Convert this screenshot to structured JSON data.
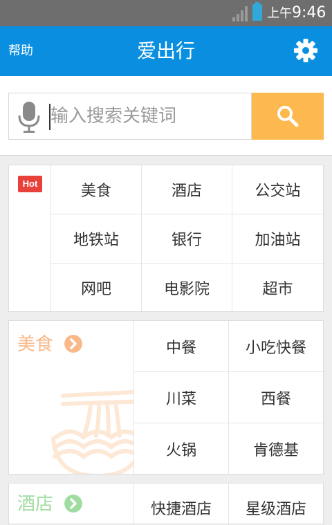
{
  "status_bar": {
    "am_pm": "上午",
    "time": "9:46"
  },
  "header": {
    "help_label": "帮助",
    "title": "爱出行"
  },
  "search": {
    "placeholder": "输入搜索关键词",
    "value": ""
  },
  "hot_section": {
    "badge": "Hot",
    "items": [
      "美食",
      "酒店",
      "公交站",
      "地铁站",
      "银行",
      "加油站",
      "网吧",
      "电影院",
      "超市"
    ]
  },
  "food_section": {
    "title": "美食",
    "color": "#f9b98a",
    "items": [
      "中餐",
      "小吃快餐",
      "川菜",
      "西餐",
      "火锅",
      "肯德基"
    ]
  },
  "hotel_section": {
    "title": "酒店",
    "color": "#9fdc9f",
    "items": [
      "快捷酒店",
      "星级酒店"
    ]
  },
  "colors": {
    "header": "#0a8fe0",
    "search_button": "#fdb94f",
    "hot_badge": "#e8413b"
  }
}
